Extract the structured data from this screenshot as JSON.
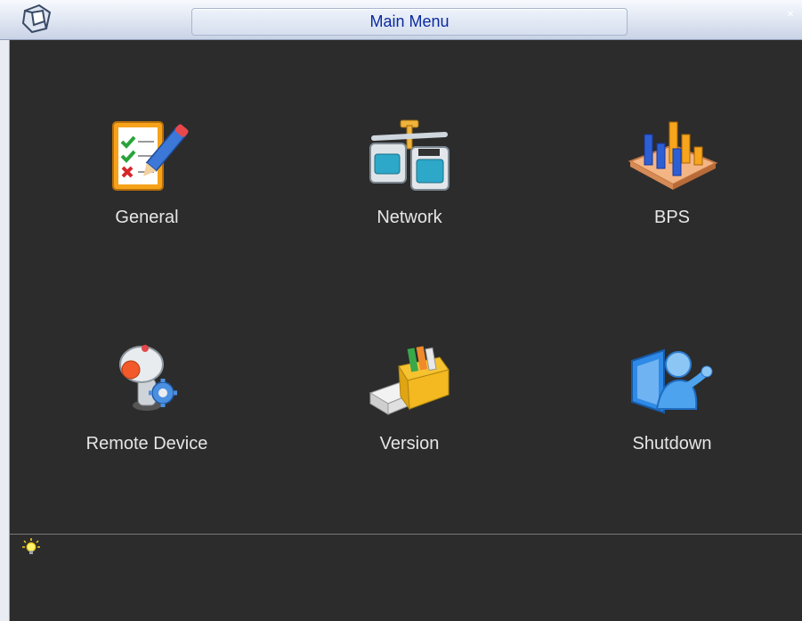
{
  "window": {
    "title": "Main Menu",
    "close_label": "×"
  },
  "menu": {
    "items": [
      {
        "label": "General",
        "icon": "general-icon"
      },
      {
        "label": "Network",
        "icon": "network-icon"
      },
      {
        "label": "BPS",
        "icon": "bps-icon"
      },
      {
        "label": "Remote Device",
        "icon": "remote-device-icon"
      },
      {
        "label": "Version",
        "icon": "version-icon"
      },
      {
        "label": "Shutdown",
        "icon": "shutdown-icon"
      }
    ]
  },
  "status": {
    "tip_icon": "lightbulb-icon",
    "tip_text": ""
  },
  "colors": {
    "titlebar_text": "#0a2a9e",
    "panel_bg": "#2c2c2c",
    "label_text": "#e6e6e6"
  }
}
